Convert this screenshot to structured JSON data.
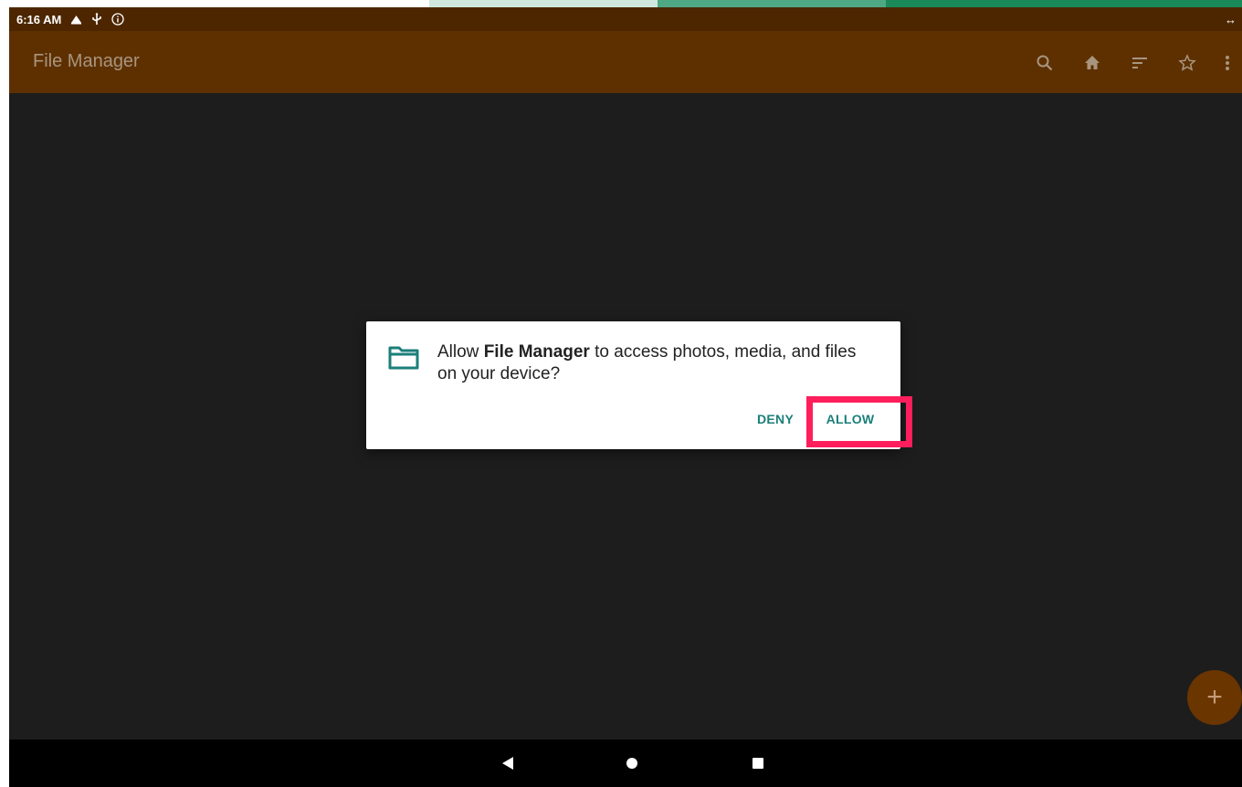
{
  "status_bar": {
    "time": "6:16 AM",
    "icons": [
      "signal-icon",
      "usb-icon",
      "info-icon"
    ],
    "right_icon": "expand-horizontal-icon",
    "right_glyph": "↔"
  },
  "app_bar": {
    "title": "File Manager",
    "actions": [
      {
        "name": "search-icon",
        "glyph": "🔍"
      },
      {
        "name": "home-icon",
        "glyph": "⌂"
      },
      {
        "name": "sort-icon",
        "glyph": "≡"
      },
      {
        "name": "star-icon",
        "glyph": "☆"
      },
      {
        "name": "more-options-icon",
        "glyph": "⋮"
      }
    ]
  },
  "dialog": {
    "icon": "folder-icon",
    "message_prefix": "Allow ",
    "app_name": "File Manager",
    "message_suffix": " to access photos, media, and files on your device?",
    "deny_label": "DENY",
    "allow_label": "ALLOW",
    "button_color": "#1b7f7a"
  },
  "highlight": {
    "target": "allow-button",
    "color": "#ff1e5c"
  },
  "fab": {
    "icon": "add-icon",
    "glyph": "+"
  },
  "nav_bar": {
    "buttons": [
      "back-icon",
      "home-circle-icon",
      "recents-icon"
    ]
  },
  "colors": {
    "status_bar": "#4d2600",
    "app_bar": "#5e3000",
    "background": "#1d1d1d",
    "dialog_background": "#ffffff"
  }
}
